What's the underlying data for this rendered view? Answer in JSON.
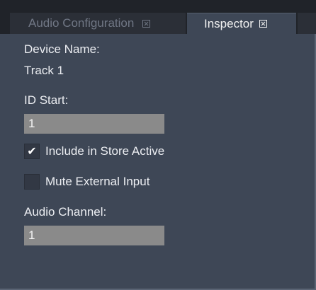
{
  "tabs": [
    {
      "label": "Audio Configuration",
      "active": false
    },
    {
      "label": "Inspector",
      "active": true
    }
  ],
  "inspector": {
    "device_name_label": "Device Name:",
    "device_name_value": "Track 1",
    "id_start_label": "ID Start:",
    "id_start_value": "1",
    "include_in_store_active": {
      "label": "Include in Store Active",
      "checked": true,
      "mark": "✔"
    },
    "mute_external_input": {
      "label": "Mute External Input",
      "checked": false,
      "mark": ""
    },
    "audio_channel_label": "Audio Channel:",
    "audio_channel_value": "1"
  },
  "colors": {
    "panel_bg": "#3e4756",
    "tabbar_bg": "#202329",
    "textbox_bg": "#8a8a8a",
    "text": "#eceef2"
  }
}
